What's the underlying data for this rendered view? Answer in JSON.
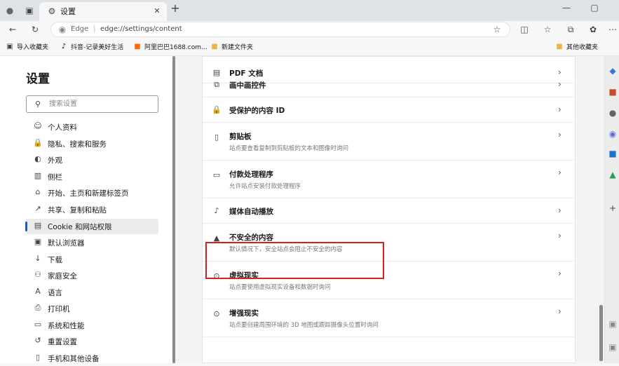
{
  "tab": {
    "title": "设置"
  },
  "address": {
    "label": "Edge",
    "url": "edge://settings/content"
  },
  "bookmarks": [
    {
      "label": "导入收藏夹"
    },
    {
      "label": "抖音-记录美好生活"
    },
    {
      "label": "阿里巴巴1688.com..."
    },
    {
      "label": "新建文件夹"
    }
  ],
  "other_bookmarks": "其他收藏夹",
  "nav": {
    "title": "设置",
    "search_placeholder": "搜索设置",
    "items": [
      {
        "label": "个人资料",
        "icon": "profile-icon",
        "glyph": "☺"
      },
      {
        "label": "隐私、搜索和服务",
        "icon": "lock-icon",
        "glyph": "🔒"
      },
      {
        "label": "外观",
        "icon": "appearance-icon",
        "glyph": "◐"
      },
      {
        "label": "侧栏",
        "icon": "sidebar-icon",
        "glyph": "▥"
      },
      {
        "label": "开始、主页和新建标签页",
        "icon": "home-icon",
        "glyph": "⌂"
      },
      {
        "label": "共享、复制和粘贴",
        "icon": "share-icon",
        "glyph": "↗"
      },
      {
        "label": "Cookie 和网站权限",
        "icon": "cookie-icon",
        "glyph": "▤"
      },
      {
        "label": "默认浏览器",
        "icon": "browser-icon",
        "glyph": "▣"
      },
      {
        "label": "下载",
        "icon": "download-icon",
        "glyph": "↓"
      },
      {
        "label": "家庭安全",
        "icon": "family-icon",
        "glyph": "⚇"
      },
      {
        "label": "语言",
        "icon": "language-icon",
        "glyph": "A"
      },
      {
        "label": "打印机",
        "icon": "printer-icon",
        "glyph": "⎙"
      },
      {
        "label": "系统和性能",
        "icon": "system-icon",
        "glyph": "▭"
      },
      {
        "label": "重置设置",
        "icon": "reset-icon",
        "glyph": "↺"
      },
      {
        "label": "手机和其他设备",
        "icon": "phone-icon",
        "glyph": "▯"
      }
    ]
  },
  "rows": [
    {
      "title": "PDF 文档",
      "sub": "",
      "icon": "pdf-icon",
      "glyph": "▤"
    },
    {
      "title": "画中画控件",
      "sub": "",
      "icon": "pip-icon",
      "glyph": "⧉"
    },
    {
      "title": "受保护的内容 ID",
      "sub": "",
      "icon": "protected-content-icon",
      "glyph": "🔒"
    },
    {
      "title": "剪贴板",
      "sub": "站点要查看复制到剪贴板的文本和图像时询问",
      "icon": "clipboard-icon",
      "glyph": "▯"
    },
    {
      "title": "付款处理程序",
      "sub": "允许站点安装付款处理程序",
      "icon": "payment-icon",
      "glyph": "▭"
    },
    {
      "title": "媒体自动播放",
      "sub": "",
      "icon": "media-icon",
      "glyph": "♪"
    },
    {
      "title": "不安全的内容",
      "sub": "默认情况下，安全站点会阻止不安全的内容",
      "icon": "warning-icon",
      "glyph": "▲"
    },
    {
      "title": "虚拟现实",
      "sub": "站点要使用虚拟现实设备和数据时询问",
      "icon": "vr-icon",
      "glyph": "⊙"
    },
    {
      "title": "增强现实",
      "sub": "站点要创建周围环境的 3D 地图或跟踪摄像头位置时询问",
      "icon": "ar-icon",
      "glyph": "⊙"
    }
  ]
}
